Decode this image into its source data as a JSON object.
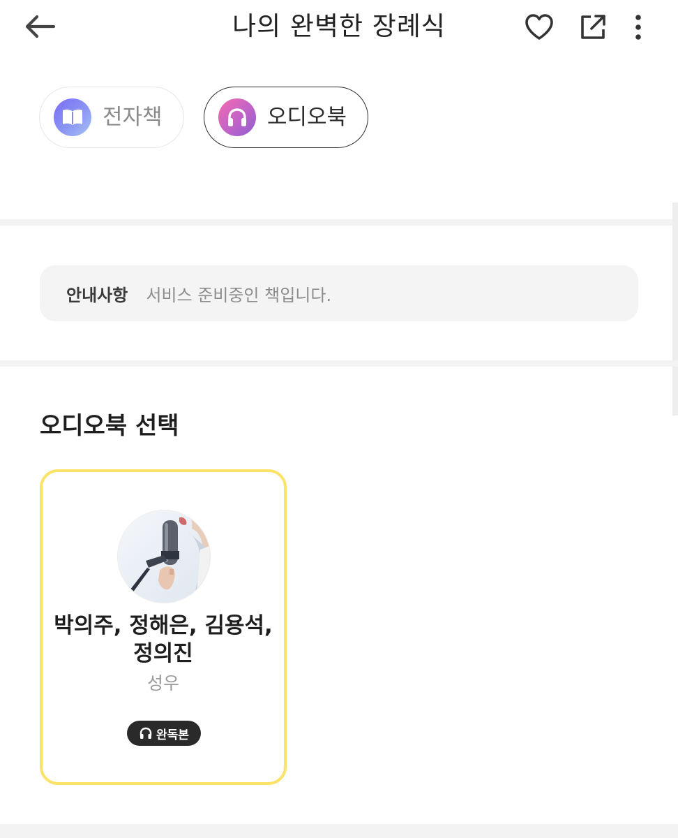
{
  "header": {
    "title": "나의 완벽한 장례식",
    "back_icon": "arrow-left-icon",
    "heart_icon": "heart-icon",
    "share_icon": "external-share-icon",
    "more_icon": "more-vertical-icon"
  },
  "formats": [
    {
      "label": "전자책",
      "icon": "book-icon",
      "selected": false
    },
    {
      "label": "오디오북",
      "icon": "headphones-icon",
      "selected": true
    }
  ],
  "notice": {
    "label": "안내사항",
    "text": "서비스 준비중인 책입니다."
  },
  "audiobook_section": {
    "title": "오디오북 선택",
    "cards": [
      {
        "narrators": "박의주, 정해은, 김용석, 정의진",
        "role": "성우",
        "badge": "완독본",
        "badge_icon": "headphones-icon",
        "selected": true
      }
    ]
  },
  "colors": {
    "selected_card_border": "#fbe36a",
    "divider": "#f3f3f3",
    "notice_bg": "#f4f4f4",
    "badge_bg": "#2a2a2a"
  }
}
